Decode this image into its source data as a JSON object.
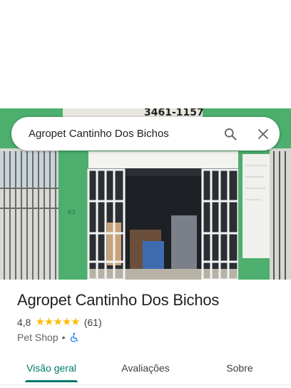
{
  "search": {
    "query": "Agropet Cantinho Dos Bichos",
    "search_icon": "search-icon",
    "close_icon": "close-icon"
  },
  "photo": {
    "sign_phone": "3461-1157",
    "street_number": "63"
  },
  "place": {
    "title": "Agropet Cantinho Dos Bichos",
    "rating": "4,8",
    "stars": 5,
    "review_count": "(61)",
    "category": "Pet Shop",
    "separator": "•",
    "accessibility_icon": "wheelchair-icon"
  },
  "tabs": [
    {
      "label": "Visão geral",
      "active": true
    },
    {
      "label": "Avaliações",
      "active": false
    },
    {
      "label": "Sobre",
      "active": false
    }
  ],
  "colors": {
    "accent": "#00796b",
    "star": "#fbbc04",
    "wall_green": "#4caf6d",
    "accessibility_blue": "#1a73e8"
  }
}
